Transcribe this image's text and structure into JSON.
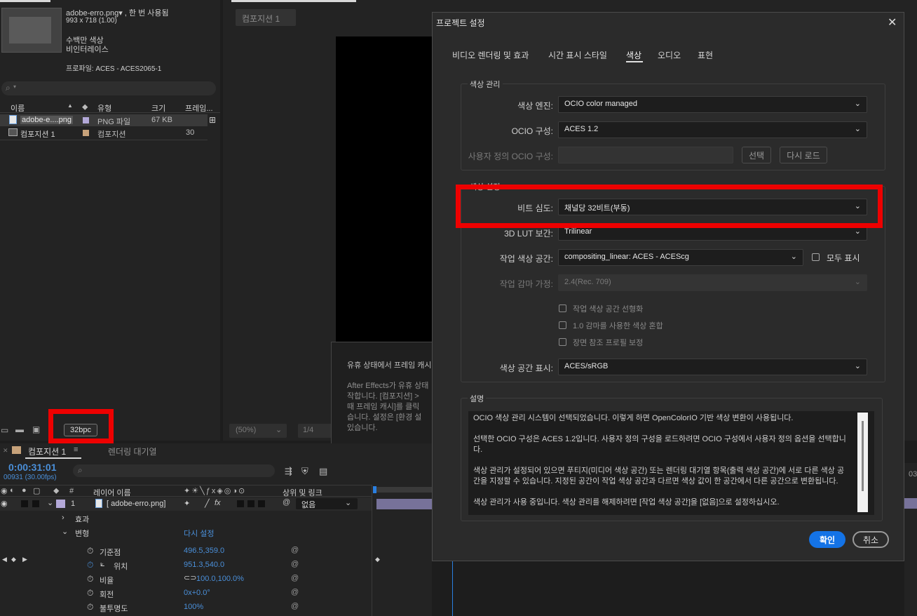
{
  "project_panel": {
    "file_name": "adobe-erro.png▾ , 한 번 사용됨",
    "dimensions": "993 x 718 (1.00)",
    "alpha": "수백만 색상",
    "interlace": "비인터레이스",
    "profile": "프로파일: ACES - ACES2065-1",
    "search_placeholder": "⚲",
    "columns": [
      "이름",
      "유형",
      "크기",
      "프레임..."
    ],
    "items": [
      {
        "name": "adobe-e....png",
        "type": "PNG 파일",
        "size": "67 KB",
        "frames": ""
      },
      {
        "name": "컴포지션 1",
        "type": "컴포지션",
        "size": "",
        "frames": "30"
      }
    ],
    "bpc": "32bpc"
  },
  "viewer": {
    "tab": "컴포지션 1",
    "zoom": "(50%)",
    "resolution": "1/4",
    "overlay_title": "유휴 상태에서 프레임 캐시",
    "overlay_body": "After Effects가 유휴 상태\n작합니다. [컴포지션] >\n때 프레임 캐시]를 클릭\n습니다. 설정은 [환경 설\n있습니다."
  },
  "timeline": {
    "tab_comp": "컴포지션 1",
    "tab_render": "렌더링 대기열",
    "timecode": "0:00:31:01",
    "frame_info": "00931 (30.00fps)",
    "col_num": "#",
    "col_layer": "레이어 이름",
    "col_parent": "상위 및 링크",
    "layer_index": "1",
    "layer_name": "[ adobe-erro.png]",
    "parent_value": "없음",
    "effects": "효과",
    "transform": "변형",
    "reset": "다시 설정",
    "props": [
      {
        "name": "기준점",
        "value": "496.5,359.0"
      },
      {
        "name": "위치",
        "value": "951.3,540.0"
      },
      {
        "name": "비율",
        "value": "100.0,100.0%"
      },
      {
        "name": "회전",
        "value": "0x+0.0°"
      },
      {
        "name": "불투명도",
        "value": "100%"
      }
    ],
    "ruler_end": "03"
  },
  "dialog": {
    "title": "프로젝트 설정",
    "tabs": [
      "비디오 렌더링 및 효과",
      "시간 표시 스타일",
      "색상",
      "오디오",
      "표현"
    ],
    "active_tab": 2,
    "color_mgmt": {
      "legend": "색상 관리",
      "engine_label": "색상 엔진:",
      "engine_value": "OCIO color managed",
      "ocio_label": "OCIO 구성:",
      "ocio_value": "ACES 1.2",
      "custom_label": "사용자 정의 OCIO 구성:",
      "select_btn": "선택",
      "reload_btn": "다시 로드"
    },
    "color_settings": {
      "legend": "색상 설정",
      "bitdepth_label": "비트 심도:",
      "bitdepth_value": "채널당 32비트(부동)",
      "lut_label": "3D LUT 보간:",
      "lut_value": "Trilinear",
      "workspace_label": "작업 색상 공간:",
      "workspace_value": "compositing_linear: ACES - ACEScg",
      "show_all": "모두 표시",
      "gamma_label": "작업 감마 가정:",
      "gamma_value": "2.4(Rec. 709)",
      "check1": "작업 색상 공간 선형화",
      "check2": "1.0 감마를 사용한 색상 혼합",
      "check3": "장면 참조 프로필 보정",
      "display_label": "색상 공간 표시:",
      "display_value": "ACES/sRGB"
    },
    "desc": {
      "legend": "설명",
      "p1": "OCIO 색상 관리 시스템이 선택되었습니다. 이렇게 하면 OpenColorIO 기반 색상 변환이 사용됩니다.",
      "p2": "선택한 OCIO 구성은 ACES 1.2입니다. 사용자 정의 구성을 로드하려면 OCIO 구성에서 사용자 정의 옵션을 선택합니다.",
      "p3": "색상 관리가 설정되어 있으면 푸티지(미디어 색상 공간) 또는 렌더링 대기열 항목(출력 색상 공간)에 서로 다른 색상 공간을 지정할 수 있습니다. 지정된 공간이 작업 색상 공간과 다르면 색상 값이 한 공간에서 다른 공간으로 변환됩니다.",
      "p4": "색상 관리가 사용 중입니다. 색상 관리를 해제하려면 [작업 색상 공간]을 [없음]으로 설정하십시오."
    },
    "ok": "확인",
    "cancel": "취소",
    "close": "✕"
  },
  "colors": {
    "highlight": "#ee0000",
    "accent": "#1473e6"
  }
}
